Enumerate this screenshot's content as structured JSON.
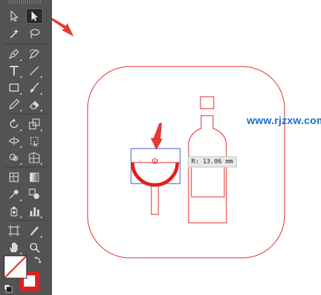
{
  "tools": [
    {
      "name": "selection-tool",
      "icon": "arrow-icon",
      "selected": false
    },
    {
      "name": "direct-selection-tool",
      "icon": "direct-arrow-icon",
      "selected": true
    },
    {
      "name": "magic-wand-tool",
      "icon": "magic-wand-icon",
      "selected": false
    },
    {
      "name": "lasso-tool",
      "icon": "lasso-icon",
      "selected": false
    },
    {
      "name": "pen-tool",
      "icon": "pen-icon",
      "selected": false
    },
    {
      "name": "curvature-tool",
      "icon": "curvature-icon",
      "selected": false
    },
    {
      "name": "type-tool",
      "icon": "type-icon",
      "selected": false
    },
    {
      "name": "line-tool",
      "icon": "line-icon",
      "selected": false
    },
    {
      "name": "rectangle-tool",
      "icon": "rectangle-icon",
      "selected": false
    },
    {
      "name": "paintbrush-tool",
      "icon": "brush-icon",
      "selected": false
    },
    {
      "name": "pencil-tool",
      "icon": "pencil-icon",
      "selected": false
    },
    {
      "name": "eraser-tool",
      "icon": "eraser-icon",
      "selected": false
    },
    {
      "name": "rotate-tool",
      "icon": "rotate-icon",
      "selected": false
    },
    {
      "name": "scale-tool",
      "icon": "scale-icon",
      "selected": false
    },
    {
      "name": "width-tool",
      "icon": "width-icon",
      "selected": false
    },
    {
      "name": "free-transform-tool",
      "icon": "free-transform-icon",
      "selected": false
    },
    {
      "name": "shape-builder-tool",
      "icon": "shape-builder-icon",
      "selected": false
    },
    {
      "name": "perspective-grid-tool",
      "icon": "perspective-grid-icon",
      "selected": false
    },
    {
      "name": "mesh-tool",
      "icon": "mesh-icon",
      "selected": false
    },
    {
      "name": "gradient-tool",
      "icon": "gradient-icon",
      "selected": false
    },
    {
      "name": "eyedropper-tool",
      "icon": "eyedropper-icon",
      "selected": false
    },
    {
      "name": "blend-tool",
      "icon": "blend-icon",
      "selected": false
    },
    {
      "name": "symbol-sprayer-tool",
      "icon": "symbol-sprayer-icon",
      "selected": false
    },
    {
      "name": "column-graph-tool",
      "icon": "column-graph-icon",
      "selected": false
    },
    {
      "name": "artboard-tool",
      "icon": "artboard-icon",
      "selected": false
    },
    {
      "name": "slice-tool",
      "icon": "slice-icon",
      "selected": false
    },
    {
      "name": "hand-tool",
      "icon": "hand-icon",
      "selected": false
    },
    {
      "name": "zoom-tool",
      "icon": "zoom-icon",
      "selected": false
    }
  ],
  "colors": {
    "toolbar_bg": "#535353",
    "stroke_red": "#e02020",
    "selection_blue": "#3a56c8",
    "arrow_red": "#e53935",
    "watermark_blue": "#1a6fd1"
  },
  "fill_stroke": {
    "fill": "none",
    "stroke": "#e02020"
  },
  "measure_tooltip": {
    "text": "R: 13.06 mm"
  },
  "watermark": {
    "text": "www.rjzxw.com"
  }
}
